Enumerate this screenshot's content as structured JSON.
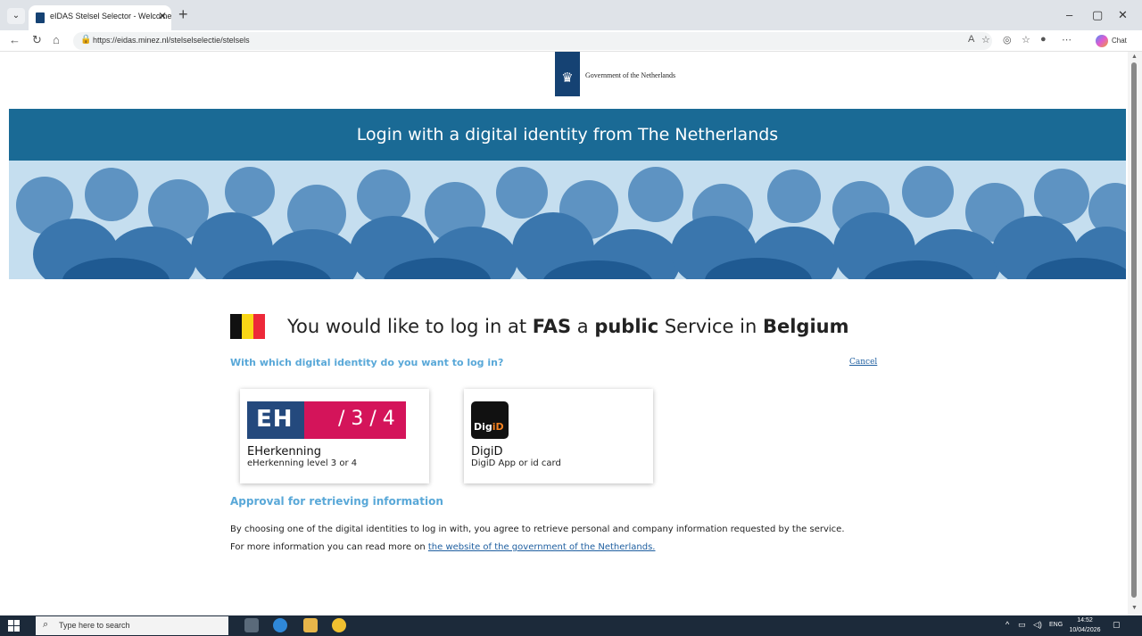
{
  "browser": {
    "tab_title": "eIDAS Stelsel Selector - Welcome",
    "tab_close": "✕",
    "new_tab": "+",
    "url": "https://eidas.minez.nl/stelselselectie/stelsels",
    "chat_label": "Chat",
    "window_controls": {
      "minimize": "–",
      "restore": "▢",
      "close": "✕"
    }
  },
  "page": {
    "gov_name": "Government of the Netherlands",
    "banner_title": "Login with a digital identity from The Netherlands",
    "intro": {
      "prefix": "You would like to log in at ",
      "org": "FAS",
      "middle1": " a ",
      "sector": "public",
      "middle2": " Service in ",
      "country": "Belgium"
    },
    "question": "With which digital identity do you want to log in?",
    "cancel": "Cancel",
    "options": [
      {
        "title": "EHerkenning",
        "subtitle": "eHerkenning level 3 or 4",
        "logo_letters": "EH",
        "logo_levels": "/ 3 / 4",
        "logo_colors": {
          "left": "#24497d",
          "right": "#d4145a"
        }
      },
      {
        "title": "DigiD",
        "subtitle": "DigiD App or id card",
        "logo_text_a": "Dig",
        "logo_text_b": "iD"
      }
    ],
    "approval_title": "Approval for retrieving information",
    "approval_text": "By choosing one of the digital identities to log in with, you agree to retrieve personal and company information requested by the service. For more information you can read more on ",
    "approval_link": "the website of the government of the Netherlands."
  },
  "flag_colors": [
    "#111111",
    "#f9d616",
    "#ed2939"
  ],
  "banner_color": "#1a6a95",
  "taskbar": {
    "search_placeholder": "Type here to search",
    "lang": "ENG",
    "time": "14:52",
    "date": "10/04/2026"
  }
}
